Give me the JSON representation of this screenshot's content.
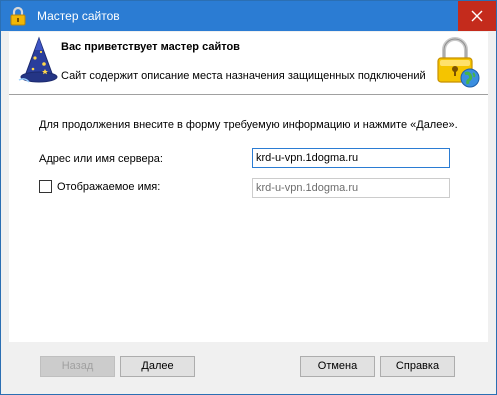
{
  "window": {
    "title": "Мастер сайтов"
  },
  "header": {
    "title": "Вас приветствует мастер сайтов",
    "subtitle": "Сайт содержит описание места назначения защищенных подключений"
  },
  "form": {
    "instruction": "Для продолжения внесите в форму требуемую информацию и нажмите «Далее».",
    "server_label": "Адрес или имя сервера:",
    "server_value": "krd-u-vpn.1dogma.ru",
    "display_name_label": "Отображаемое имя:",
    "display_name_value": "krd-u-vpn.1dogma.ru",
    "display_name_checked": false
  },
  "buttons": {
    "back": "Назад",
    "next": "Далее",
    "cancel": "Отмена",
    "help": "Справка"
  },
  "icons": {
    "title": "lock-icon",
    "close": "close-icon",
    "wizard": "wizard-hat-icon",
    "header_lock": "lock-globe-icon"
  },
  "colors": {
    "titlebar": "#2b7cd3",
    "close": "#c42b1c",
    "focus_border": "#2b7cd3"
  }
}
